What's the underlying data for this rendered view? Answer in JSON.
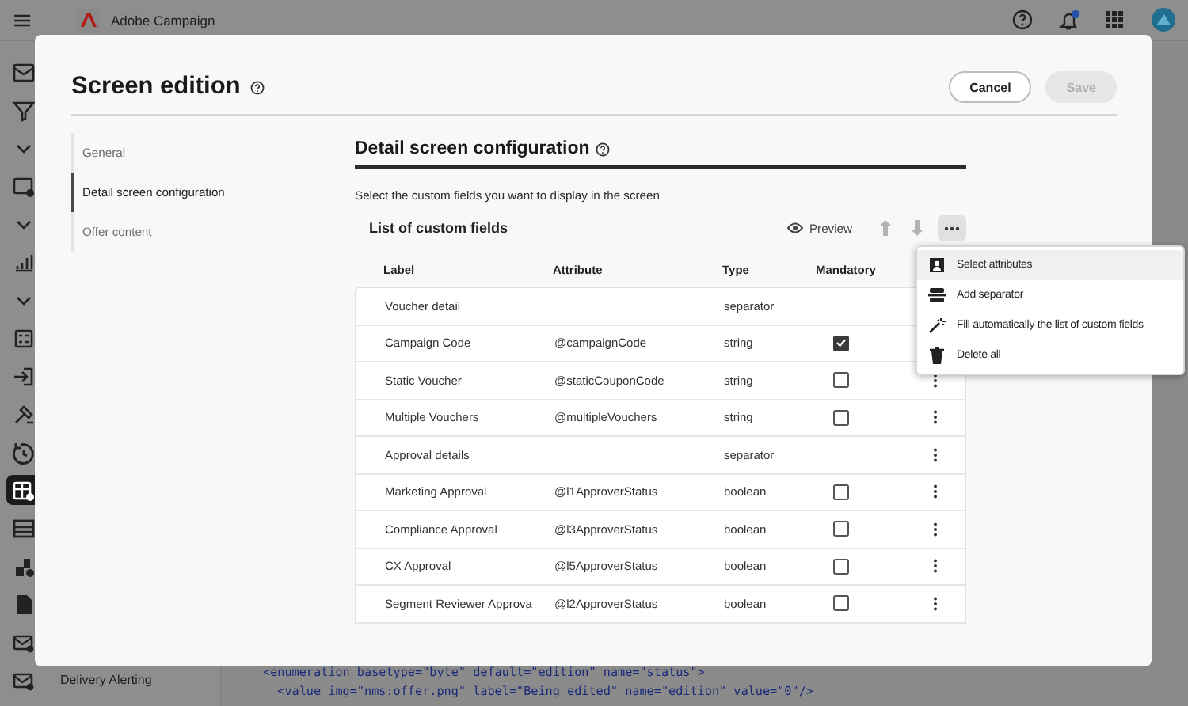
{
  "app": {
    "title": "Adobe Campaign"
  },
  "nav_rail": [
    {
      "selected": false
    },
    {
      "selected": false
    },
    {
      "selected": false
    },
    {
      "selected": false
    },
    {
      "selected": false
    },
    {
      "selected": false
    },
    {
      "selected": false
    },
    {
      "selected": false
    },
    {
      "selected": false
    },
    {
      "selected": false
    },
    {
      "selected": false
    },
    {
      "selected": true
    },
    {
      "selected": false
    },
    {
      "selected": false
    },
    {
      "selected": false
    },
    {
      "selected": false
    },
    {
      "selected": false,
      "label": "Delivery Alerting"
    }
  ],
  "code_lines": [
    "<enumeration basetype=\"byte\" default=\"edition\" name=\"status\">",
    "  <value img=\"nms:offer.png\" label=\"Being edited\" name=\"edition\" value=\"0\"/>"
  ],
  "dialog": {
    "title": "Screen edition",
    "buttons": [
      {
        "label": "Cancel",
        "disabled": false
      },
      {
        "label": "Save",
        "disabled": true
      }
    ],
    "sections": [
      {
        "label": "General",
        "selected": false
      },
      {
        "label": "Detail screen configuration",
        "selected": true
      },
      {
        "label": "Offer content",
        "selected": false
      }
    ],
    "heading": "Detail screen configuration",
    "description": "Select the custom fields you want to display in the screen",
    "list_title": "List of custom fields",
    "preview": "Preview",
    "columns": [
      "Label",
      "Attribute",
      "Type",
      "Mandatory"
    ],
    "rows": [
      {
        "kind": "separator",
        "label": "Voucher detail",
        "attribute": "",
        "type": "separator",
        "actions": false
      },
      {
        "kind": "field",
        "label": "Campaign Code",
        "attribute": "@campaignCode",
        "type": "string",
        "mandatory": true,
        "actions": false
      },
      {
        "kind": "field",
        "label": "Static Voucher",
        "attribute": "@staticCouponCode",
        "type": "string",
        "mandatory": false,
        "actions": true
      },
      {
        "kind": "field",
        "label": "Multiple Vouchers",
        "attribute": "@multipleVouchers",
        "type": "string",
        "mandatory": false,
        "actions": true
      },
      {
        "kind": "separator",
        "label": "Approval details",
        "attribute": "",
        "type": "separator",
        "actions": true
      },
      {
        "kind": "field",
        "label": "Marketing Approval",
        "attribute": "@l1ApproverStatus",
        "type": "boolean",
        "mandatory": false,
        "actions": true
      },
      {
        "kind": "field",
        "label": "Compliance Approval",
        "attribute": "@l3ApproverStatus",
        "type": "boolean",
        "mandatory": false,
        "actions": true
      },
      {
        "kind": "field",
        "label": "CX Approval",
        "attribute": "@l5ApproverStatus",
        "type": "boolean",
        "mandatory": false,
        "actions": true
      },
      {
        "kind": "field",
        "label": "Segment Reviewer Approva",
        "attribute": "@l2ApproverStatus",
        "type": "boolean",
        "mandatory": false,
        "actions": true
      }
    ],
    "menu": [
      {
        "kind": "select",
        "label": "Select attributes",
        "selected": true
      },
      {
        "kind": "separator",
        "label": "Add separator",
        "selected": false
      },
      {
        "kind": "fill",
        "label": "Fill automatically the list of custom fields",
        "selected": false
      },
      {
        "kind": "delete",
        "label": "Delete all",
        "selected": false
      }
    ]
  }
}
